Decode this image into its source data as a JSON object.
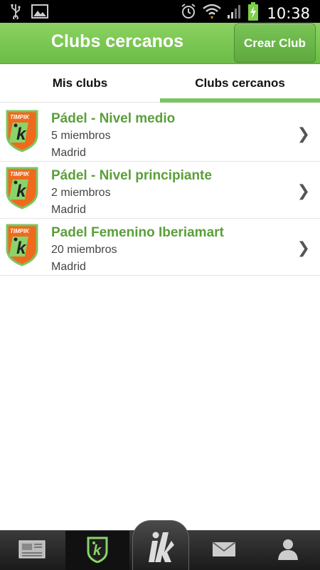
{
  "status_bar": {
    "time": "10:38",
    "icons": [
      "usb-icon",
      "image-icon",
      "alarm-icon",
      "wifi-icon",
      "signal-icon",
      "battery-charging-icon"
    ]
  },
  "action_bar": {
    "title": "Clubs cercanos",
    "create_button_label": "Crear Club"
  },
  "tabs": [
    {
      "label": "Mis clubs",
      "selected": false
    },
    {
      "label": "Clubs cercanos",
      "selected": true
    }
  ],
  "clubs": [
    {
      "logo_text": "TIMPIK",
      "name": "Pádel - Nivel medio",
      "members": "5 miembros",
      "city": "Madrid"
    },
    {
      "logo_text": "TIMPIK",
      "name": "Pádel - Nivel principiante",
      "members": "2 miembros",
      "city": "Madrid"
    },
    {
      "logo_text": "TIMPIK",
      "name": "Padel Femenino Iberiamart",
      "members": "20 miembros",
      "city": "Madrid"
    }
  ],
  "bottom_nav": {
    "items": [
      "news-icon",
      "clubs-shield-icon",
      "timpik-home-icon",
      "mail-icon",
      "profile-icon"
    ],
    "selected": "clubs-shield-icon"
  },
  "colors": {
    "accent_green": "#6cbc46",
    "club_name_green": "#5b9f3a",
    "tab_indicator": "#7dc462",
    "logo_orange": "#ef6a1d"
  }
}
